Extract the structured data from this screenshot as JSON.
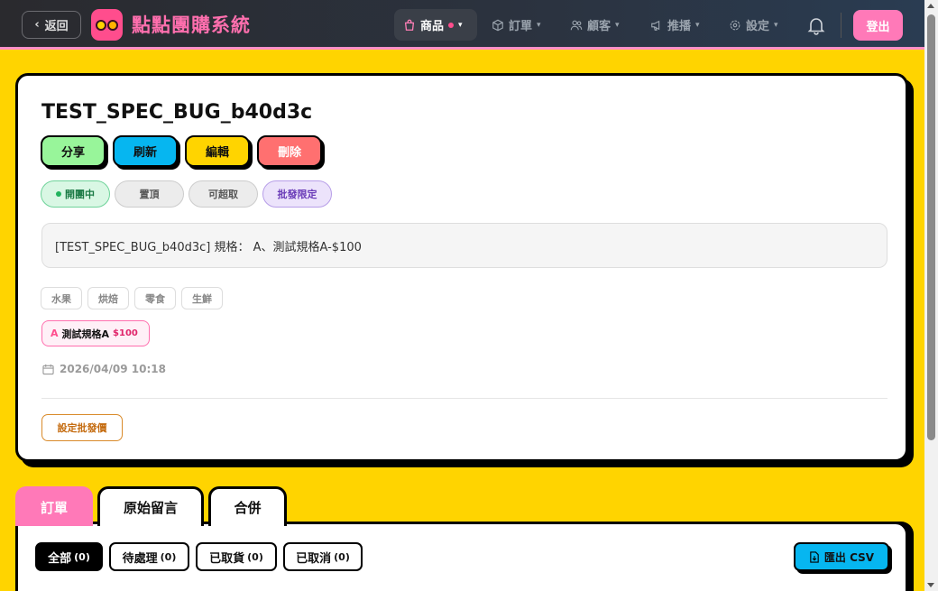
{
  "nav": {
    "back_label": "返回",
    "brand": "點點團購系統",
    "items": [
      {
        "label": "商品",
        "icon": "bag-icon"
      },
      {
        "label": "訂單",
        "icon": "box-icon"
      },
      {
        "label": "顧客",
        "icon": "users-icon"
      },
      {
        "label": "推播",
        "icon": "megaphone-icon"
      },
      {
        "label": "設定",
        "icon": "gear-icon"
      }
    ],
    "logout_label": "登出"
  },
  "product": {
    "title": "TEST_SPEC_BUG_b40d3c",
    "actions": [
      {
        "label": "分享",
        "color": "#98f59a"
      },
      {
        "label": "刷新",
        "color": "#06b6f0"
      },
      {
        "label": "編輯",
        "color": "#ffd400"
      },
      {
        "label": "刪除",
        "color": "#ff7070"
      }
    ],
    "status_chips": [
      "開團中",
      "置頂",
      "可超取",
      "批發限定"
    ],
    "description": "[TEST_SPEC_BUG_b40d3c] 規格： A、測試規格A-$100",
    "tags": [
      "水果",
      "烘焙",
      "零食",
      "生鮮"
    ],
    "spec": {
      "letter": "A",
      "name": "測試規格A",
      "price": "$100"
    },
    "date": "2026/04/09 10:18",
    "wholesale_label": "設定批發價"
  },
  "tabs": [
    "訂單",
    "原始留言",
    "合併"
  ],
  "filters": [
    {
      "label": "全部",
      "count": "(0)"
    },
    {
      "label": "待處理",
      "count": "(0)"
    },
    {
      "label": "已取貨",
      "count": "(0)"
    },
    {
      "label": "已取消",
      "count": "(0)"
    }
  ],
  "export_label": "匯出 CSV"
}
